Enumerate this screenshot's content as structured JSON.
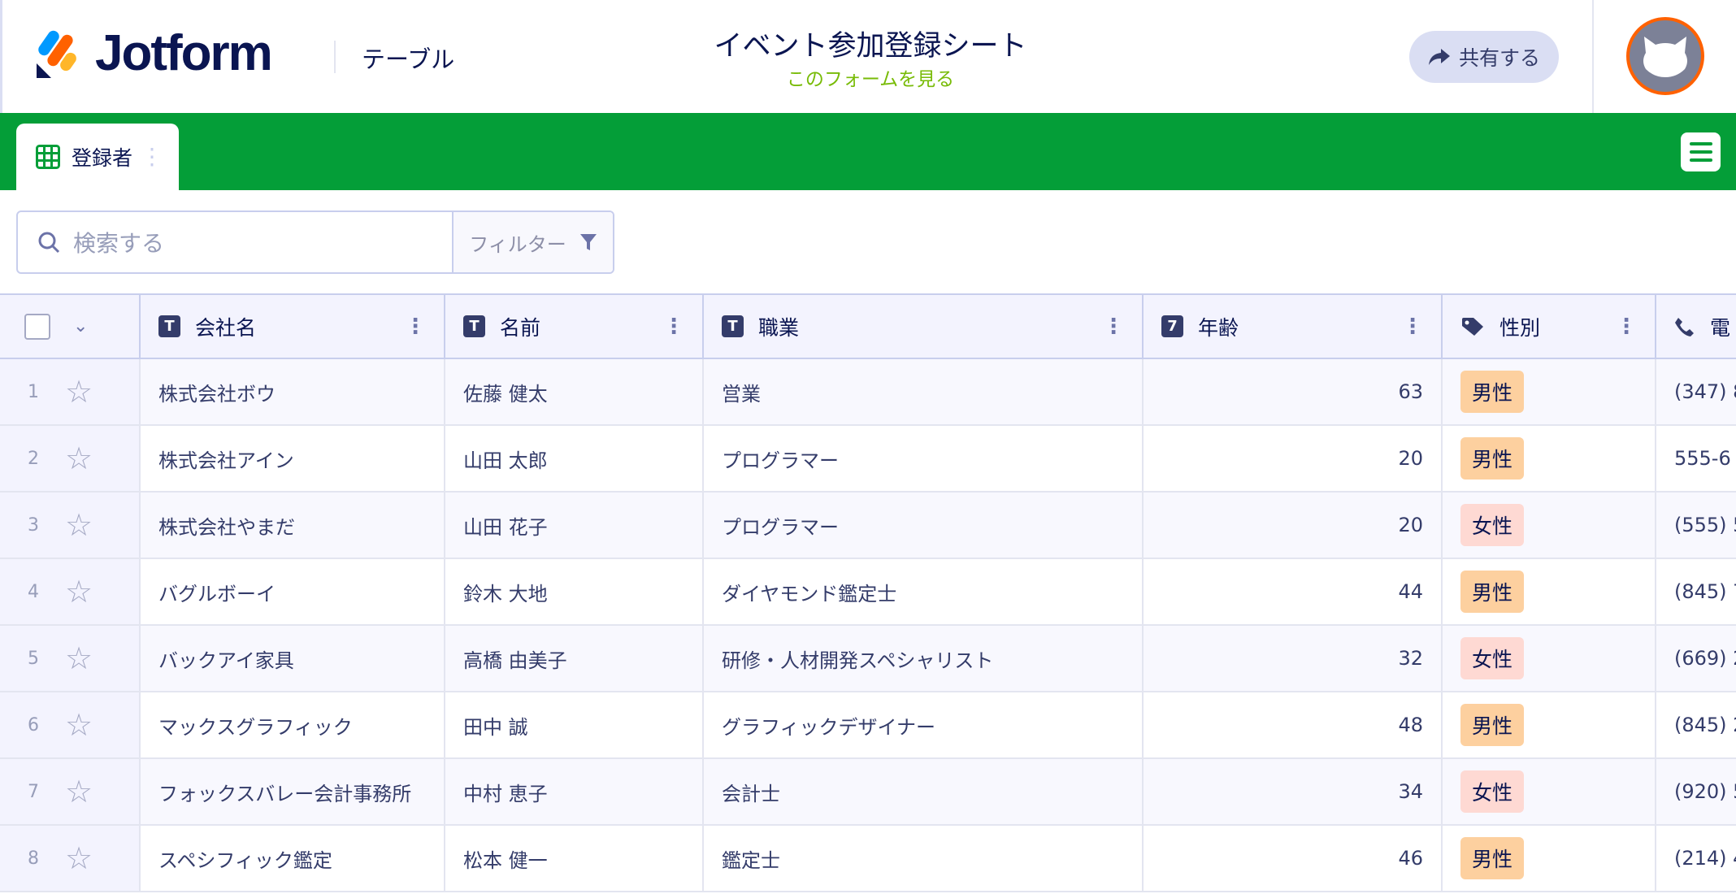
{
  "header": {
    "brand": "Jotform",
    "product": "テーブル",
    "title": "イベント参加登録シート",
    "subtitle": "このフォームを見る",
    "share_label": "共有する"
  },
  "tabs": [
    {
      "label": "登録者"
    }
  ],
  "search": {
    "placeholder": "検索する",
    "filter_label": "フィルター"
  },
  "colors": {
    "green": "#049e38",
    "male": "#fdd09f",
    "female": "#fed9d3"
  },
  "table": {
    "columns": [
      {
        "label": "会社名",
        "icon": "text-icon",
        "icon_glyph": "T"
      },
      {
        "label": "名前",
        "icon": "text-icon",
        "icon_glyph": "T"
      },
      {
        "label": "職業",
        "icon": "text-icon",
        "icon_glyph": "T"
      },
      {
        "label": "年齢",
        "icon": "number-icon",
        "icon_glyph": "7"
      },
      {
        "label": "性別",
        "icon": "tag-icon"
      },
      {
        "label": "電",
        "icon": "phone-icon"
      }
    ],
    "rows": [
      {
        "n": "1",
        "company": "株式会社ボウ",
        "name": "佐藤 健太",
        "job": "営業",
        "age": "63",
        "gender": "男性",
        "g": "m",
        "phone": "(347) 8"
      },
      {
        "n": "2",
        "company": "株式会社アイン",
        "name": "山田 太郎",
        "job": "プログラマー",
        "age": "20",
        "gender": "男性",
        "g": "m",
        "phone": "555-6"
      },
      {
        "n": "3",
        "company": "株式会社やまだ",
        "name": "山田 花子",
        "job": "プログラマー",
        "age": "20",
        "gender": "女性",
        "g": "f",
        "phone": "(555) 5"
      },
      {
        "n": "4",
        "company": "バグルボーイ",
        "name": "鈴木 大地",
        "job": "ダイヤモンド鑑定士",
        "age": "44",
        "gender": "男性",
        "g": "m",
        "phone": "(845) 7"
      },
      {
        "n": "5",
        "company": "バックアイ家具",
        "name": "高橋 由美子",
        "job": "研修・人材開発スペシャリスト",
        "age": "32",
        "gender": "女性",
        "g": "f",
        "phone": "(669) 2"
      },
      {
        "n": "6",
        "company": "マックスグラフィック",
        "name": "田中 誠",
        "job": "グラフィックデザイナー",
        "age": "48",
        "gender": "男性",
        "g": "m",
        "phone": "(845) 2"
      },
      {
        "n": "7",
        "company": "フォックスバレー会計事務所",
        "name": "中村 恵子",
        "job": "会計士",
        "age": "34",
        "gender": "女性",
        "g": "f",
        "phone": "(920) 5"
      },
      {
        "n": "8",
        "company": "スペシフィック鑑定",
        "name": "松本 健一",
        "job": "鑑定士",
        "age": "46",
        "gender": "男性",
        "g": "m",
        "phone": "(214) 4"
      }
    ]
  }
}
